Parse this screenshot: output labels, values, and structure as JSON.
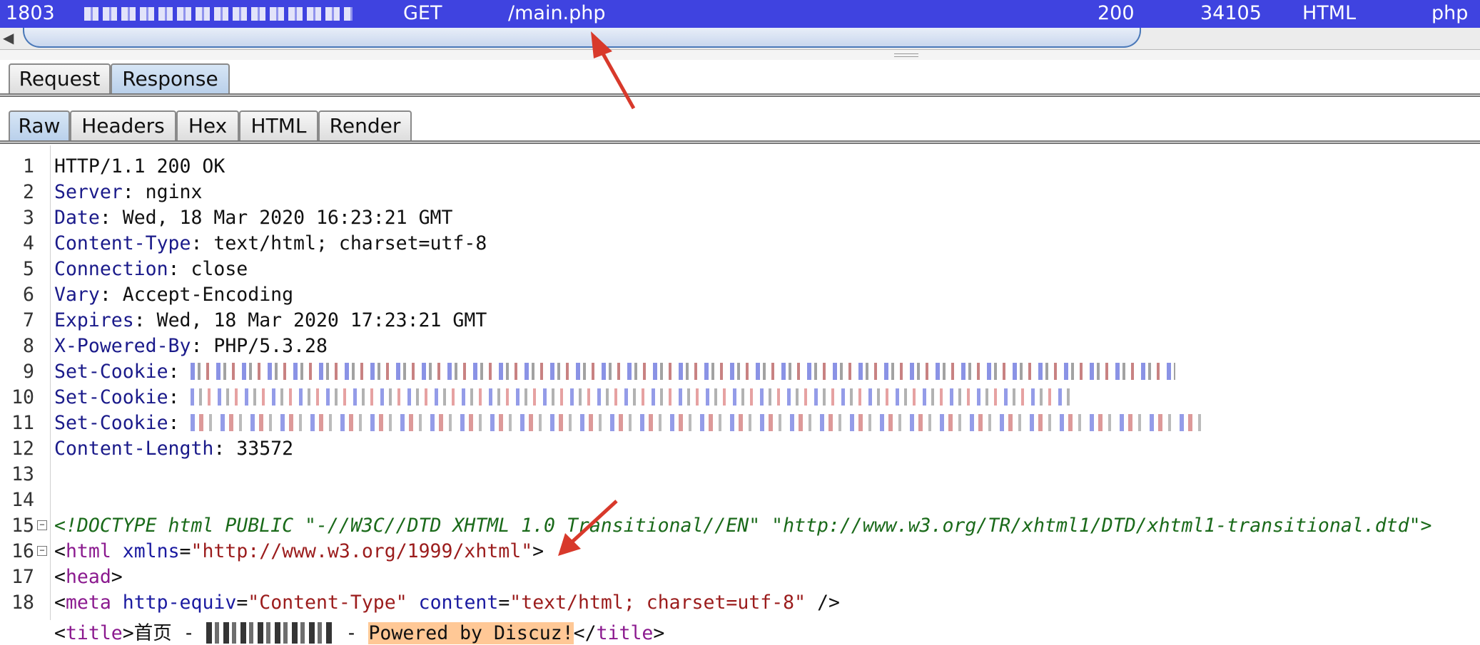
{
  "row": {
    "id": "1803",
    "method": "GET",
    "path": "/main.php",
    "status": "200",
    "length": "34105",
    "mime": "HTML",
    "ext": "php"
  },
  "scroll_left_icon": "left-arrow-icon",
  "tabs": {
    "top": [
      "Request",
      "Response"
    ],
    "top_active": "Response",
    "sub": [
      "Raw",
      "Headers",
      "Hex",
      "HTML",
      "Render"
    ],
    "sub_active": "Raw"
  },
  "lines": {
    "n": [
      "1",
      "2",
      "3",
      "4",
      "5",
      "6",
      "7",
      "8",
      "9",
      "10",
      "11",
      "12",
      "13",
      "14",
      "15",
      "16",
      "17",
      "18"
    ],
    "l1": "HTTP/1.1 200 OK",
    "h2": "Server",
    "v2": "nginx",
    "h3": "Date",
    "v3": "Wed, 18 Mar 2020 16:23:21 GMT",
    "h4": "Content-Type",
    "v4": "text/html; charset=utf-8",
    "h5": "Connection",
    "v5": "close",
    "h6": "Vary",
    "v6": "Accept-Encoding",
    "h7": "Expires",
    "v7": "Wed, 18 Mar 2020 17:23:21 GMT",
    "h8": "X-Powered-By",
    "v8": "PHP/5.3.28",
    "h9": "Set-Cookie",
    "h10": "Set-Cookie",
    "h11": "Set-Cookie",
    "h12": "Content-Length",
    "v12": "33572",
    "l14": "<!DOCTYPE html PUBLIC \"-//W3C//DTD XHTML 1.0 Transitional//EN\" \"http://www.w3.org/TR/xhtml1/DTD/xhtml1-transitional.dtd\">",
    "l15_tag": "html",
    "l15_att": "xmlns",
    "l15_val": "\"http://www.w3.org/1999/xhtml\"",
    "l16_tag": "head",
    "l17_tag": "meta",
    "l17_att1": "http-equiv",
    "l17_val1": "\"Content-Type\"",
    "l17_att2": "content",
    "l17_val2": "\"text/html; charset=utf-8\"",
    "l18_tag": "title",
    "l18_text": "首页 - ",
    "l18_sep": " - ",
    "l18_hl": "Powered by Discuz!"
  },
  "colors": {
    "selected_row": "#3f43e0",
    "highlight": "#ffc896",
    "arrow": "#d8392b"
  }
}
